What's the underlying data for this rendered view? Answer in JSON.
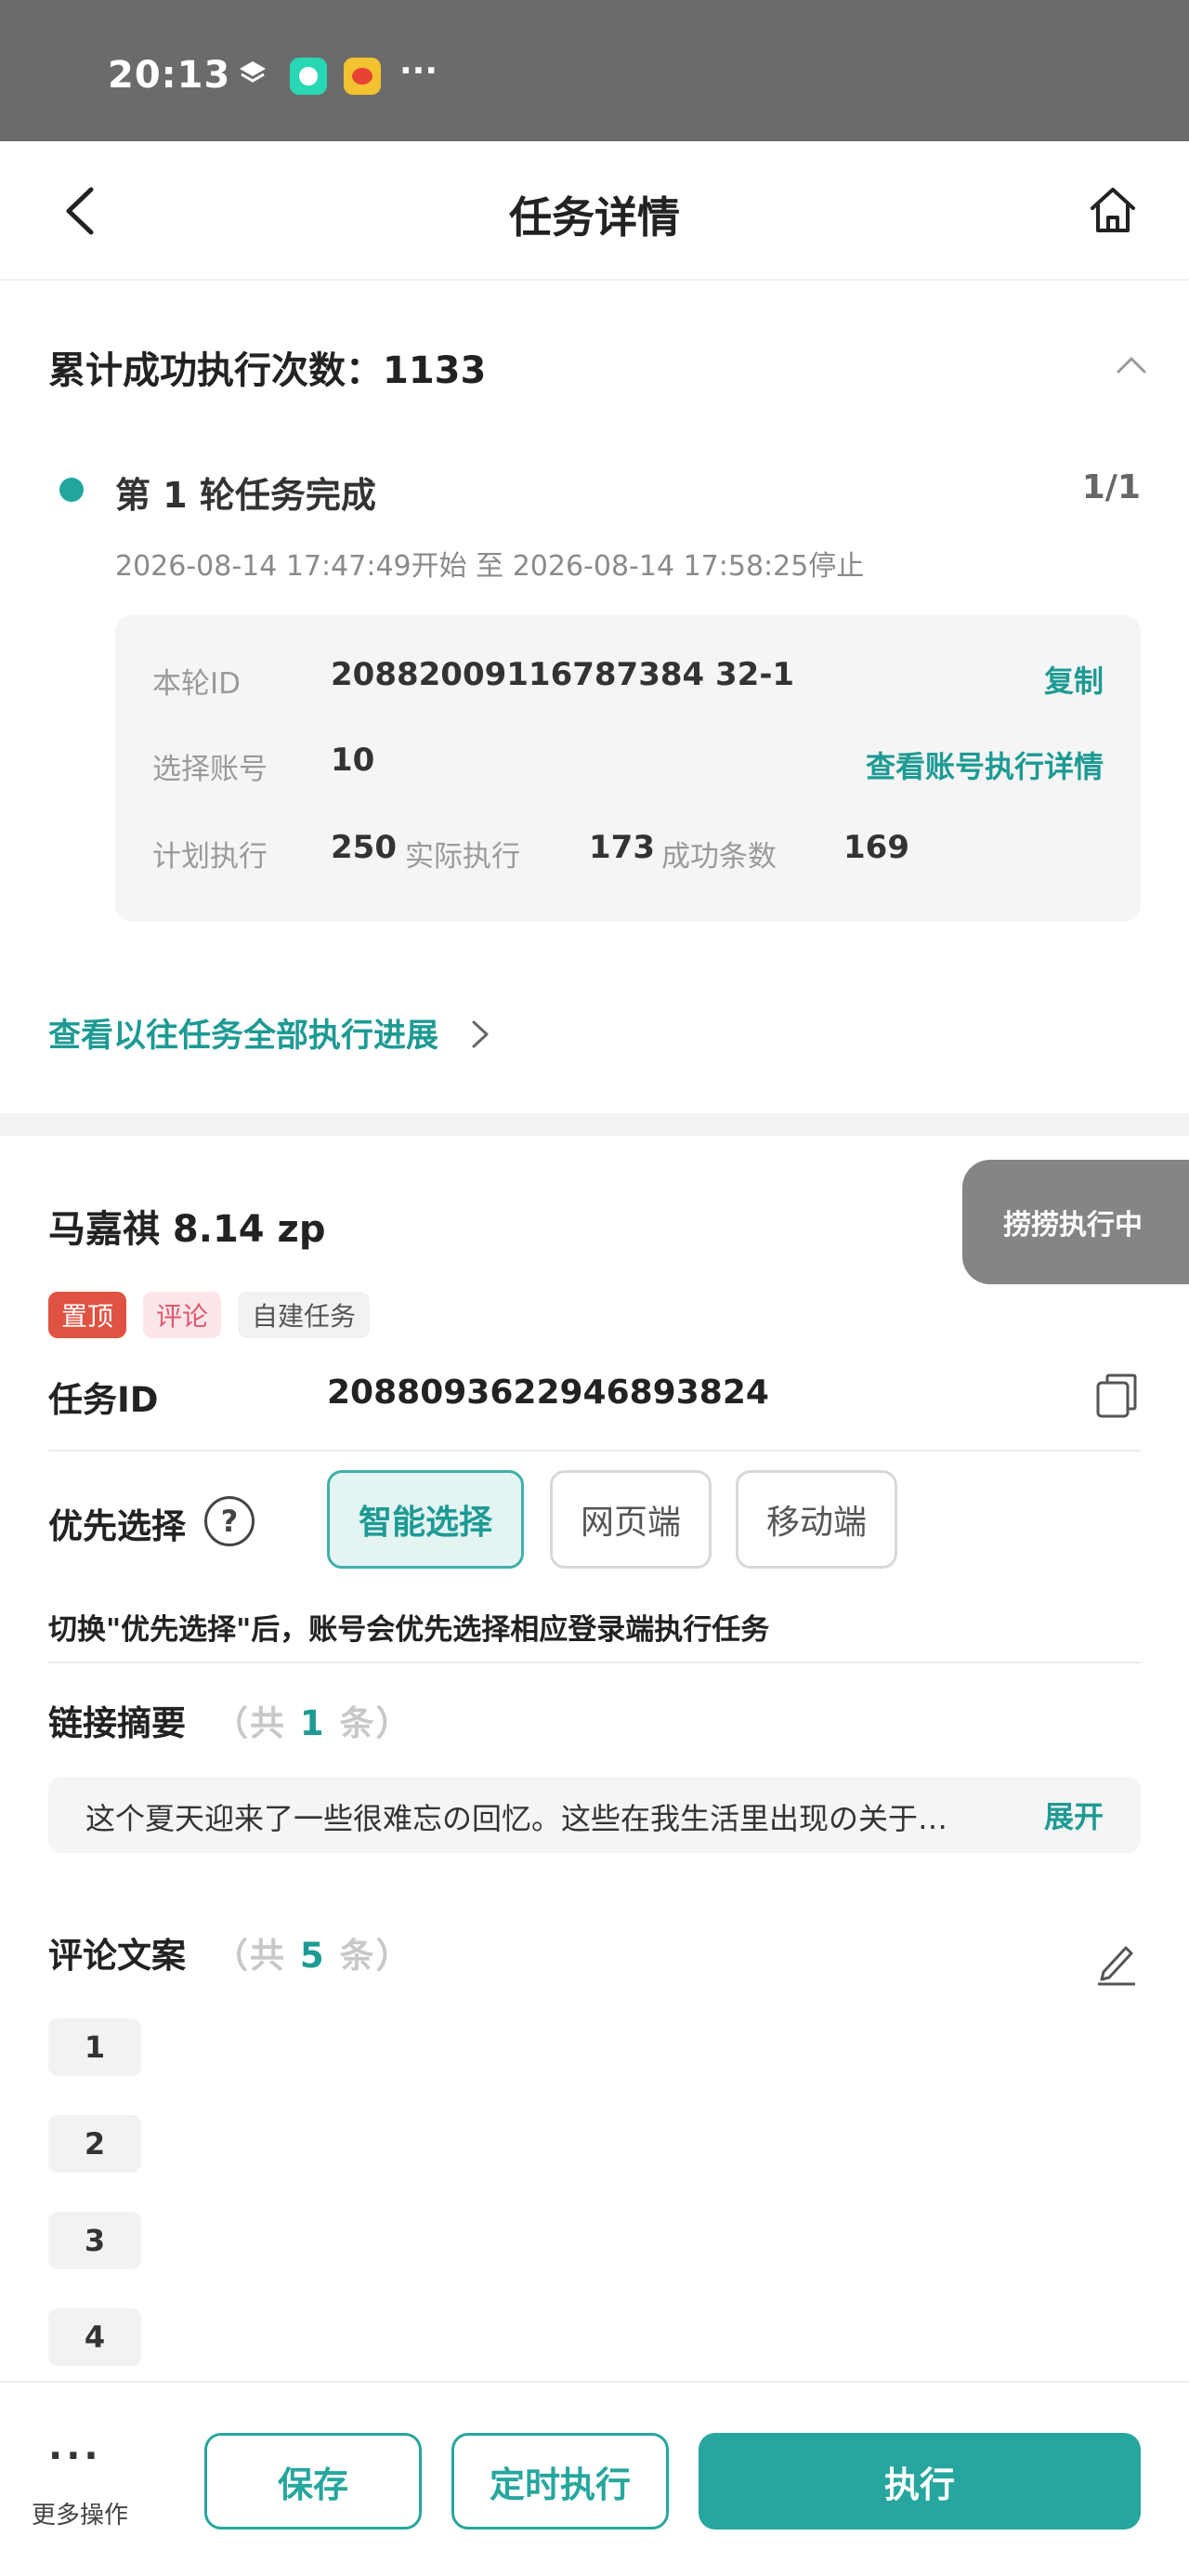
{
  "status_bar": {
    "time": "20:13",
    "more": "···"
  },
  "nav": {
    "title": "任务详情"
  },
  "summary": {
    "label": "累计成功执行次数：1133"
  },
  "round": {
    "title": "第  1  轮任务完成",
    "count": "1/1",
    "time_range": "2026-08-14  17:47:49开始  至  2026-08-14  17:58:25停止",
    "card": {
      "round_id_label": "本轮ID",
      "round_id_value": "20882009116787384 32-1",
      "copy_label": "复制",
      "account_label": "选择账号",
      "account_value": "10",
      "account_link": "查看账号执行详情",
      "plan_label": "计划执行",
      "plan_value": "250",
      "actual_label": "实际执行",
      "actual_value": "173",
      "success_label": "成功条数",
      "success_value": "169"
    }
  },
  "history_link": "查看以往任务全部执行进展",
  "task": {
    "title": "马嘉祺  8.14  zp",
    "exec_badge": "捞捞执行中",
    "tags": [
      "置顶",
      "评论",
      "自建任务"
    ],
    "task_id_label": "任务ID",
    "task_id_value": "2088093622946893824",
    "priority_label": "优先选择",
    "priority_options": [
      "智能选择",
      "网页端",
      "移动端"
    ],
    "priority_selected": "智能选择",
    "switch_hint": "切换\"优先选择\"后，账号会优先选择相应登录端执行任务",
    "link_summary_label": "链接摘要",
    "link_count_prefix": "（共",
    "link_count": "1",
    "link_count_suffix": "条）",
    "link_summary_text": "这个夏天迎来了一些很难忘の回忆。这些在我生活里出现の关于…",
    "expand_label": "展开",
    "comment_label": "评论文案",
    "comment_count_prefix": "（共",
    "comment_count": "5",
    "comment_count_suffix": "条）",
    "comment_items": [
      "1",
      "2",
      "3",
      "4"
    ]
  },
  "bottom_bar": {
    "more_dots": "···",
    "more_label": "更多操作",
    "save": "保存",
    "schedule": "定时执行",
    "execute": "执行"
  },
  "colors": {
    "accent": "#26a69e",
    "tag_pin": "#e05242",
    "tag_comment": "#e0566b",
    "status_bar": "#6b6b6b"
  }
}
